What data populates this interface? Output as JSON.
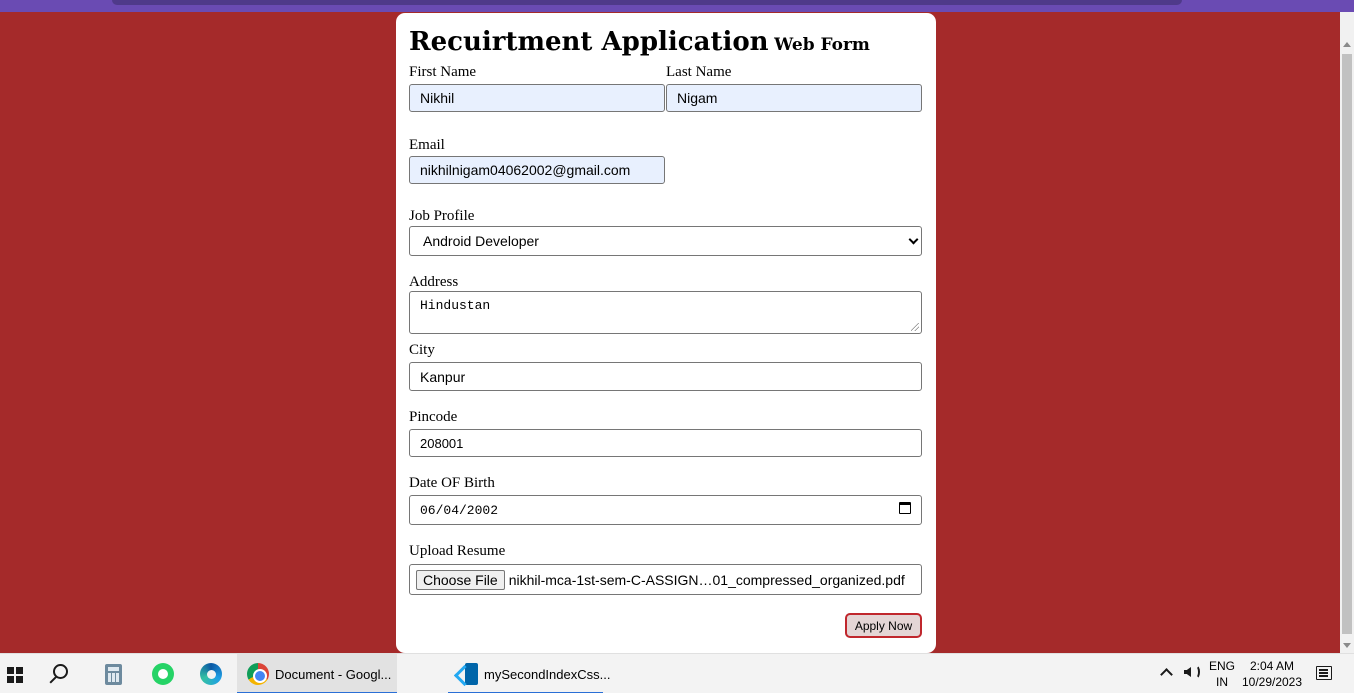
{
  "form": {
    "title": "Recuirtment Application",
    "title_suffix": "Web Form",
    "first_name": {
      "label": "First Name",
      "value": "Nikhil"
    },
    "last_name": {
      "label": "Last Name",
      "value": "Nigam"
    },
    "email": {
      "label": "Email",
      "value": "nikhilnigam04062002@gmail.com"
    },
    "job_profile": {
      "label": "Job Profile",
      "selected": "Android Developer"
    },
    "address": {
      "label": "Address",
      "value": "Hindustan"
    },
    "city": {
      "label": "City",
      "value": "Kanpur"
    },
    "pincode": {
      "label": "Pincode",
      "value": "208001"
    },
    "dob": {
      "label": "Date OF Birth",
      "value": "06/04/2002"
    },
    "resume": {
      "label": "Upload Resume",
      "button": "Choose File",
      "file_name": "nikhil-mca-1st-sem-C-ASSIGN…01_compressed_organized.pdf"
    },
    "submit_label": "Apply Now"
  },
  "taskbar": {
    "icons": [
      "windows-start-icon",
      "search-icon",
      "calculator-icon",
      "whatsapp-icon",
      "edge-icon"
    ],
    "apps": [
      {
        "label": "Document - Googl...",
        "icon": "chrome-icon",
        "active": true
      },
      {
        "label": "mySecondIndexCss...",
        "icon": "vscode-icon",
        "active": false
      }
    ],
    "lang_line1": "ENG",
    "lang_line2": "IN",
    "time": "2:04 AM",
    "date": "10/29/2023"
  },
  "colors": {
    "page_background": "#a52a2a",
    "autofill_background": "#e8f0fe",
    "submit_border": "#c0272d",
    "browser_strip": "#6a4bb3"
  }
}
